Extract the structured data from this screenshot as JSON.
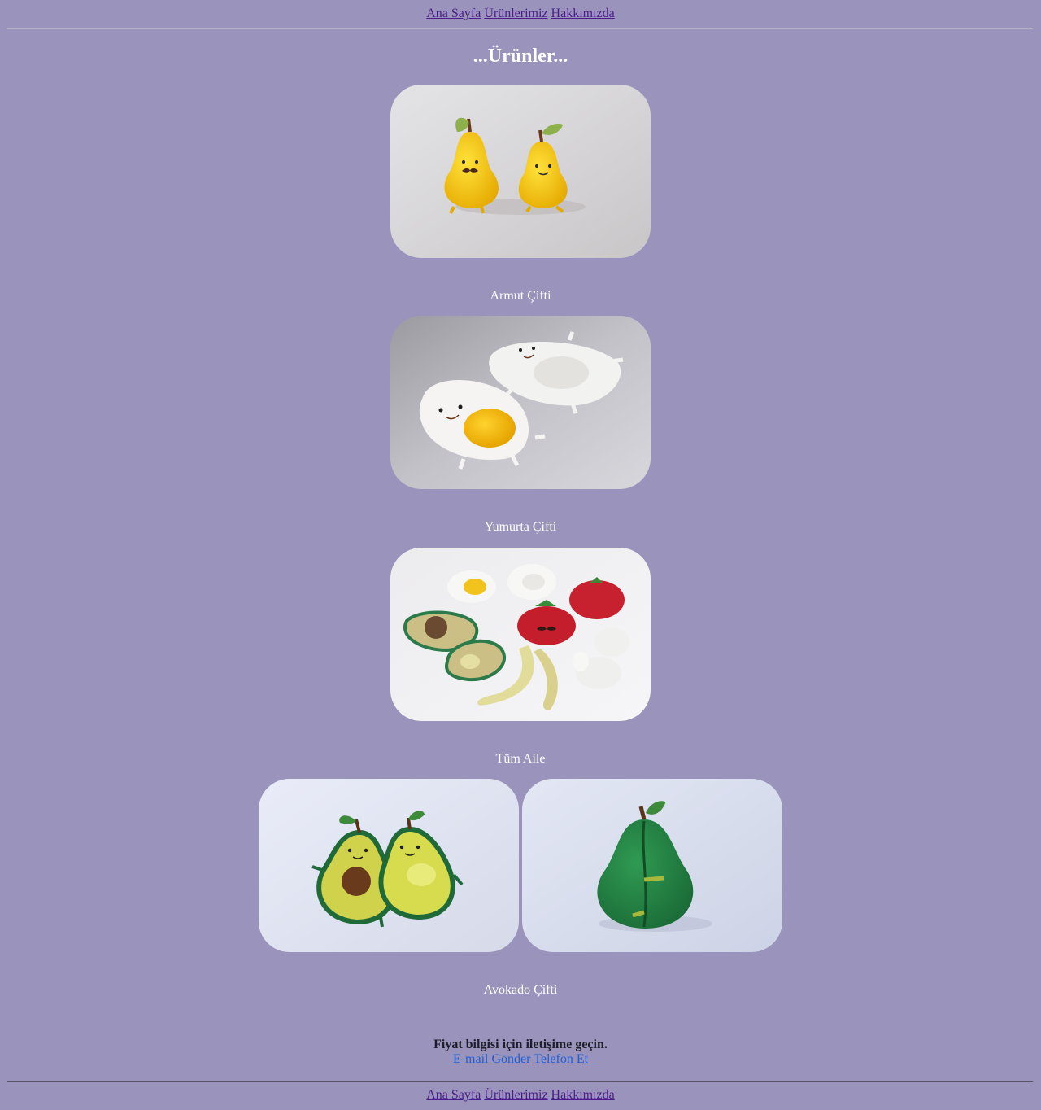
{
  "nav": {
    "items": [
      "Ana Sayfa",
      "Ürünlerimiz",
      "Hakkımızda"
    ]
  },
  "page": {
    "title": "...Ürünler..."
  },
  "products": [
    {
      "caption": "Armut Çifti",
      "image": "pear-couple-photo"
    },
    {
      "caption": "Yumurta Çifti",
      "image": "egg-couple-photo"
    },
    {
      "caption": "Tüm Aile",
      "image": "whole-family-photo"
    },
    {
      "caption": "Avokado Çifti",
      "images": [
        "avocado-couple-front-photo",
        "avocado-couple-back-photo"
      ]
    }
  ],
  "contact": {
    "heading": "Fiyat bilgisi için iletişime geçin.",
    "email_label": "E-mail Gönder",
    "phone_label": "Telefon Et"
  },
  "colors": {
    "background": "#9a93bb",
    "nav_link": "#4b1c8a",
    "contact_link": "#1f5fd6"
  }
}
